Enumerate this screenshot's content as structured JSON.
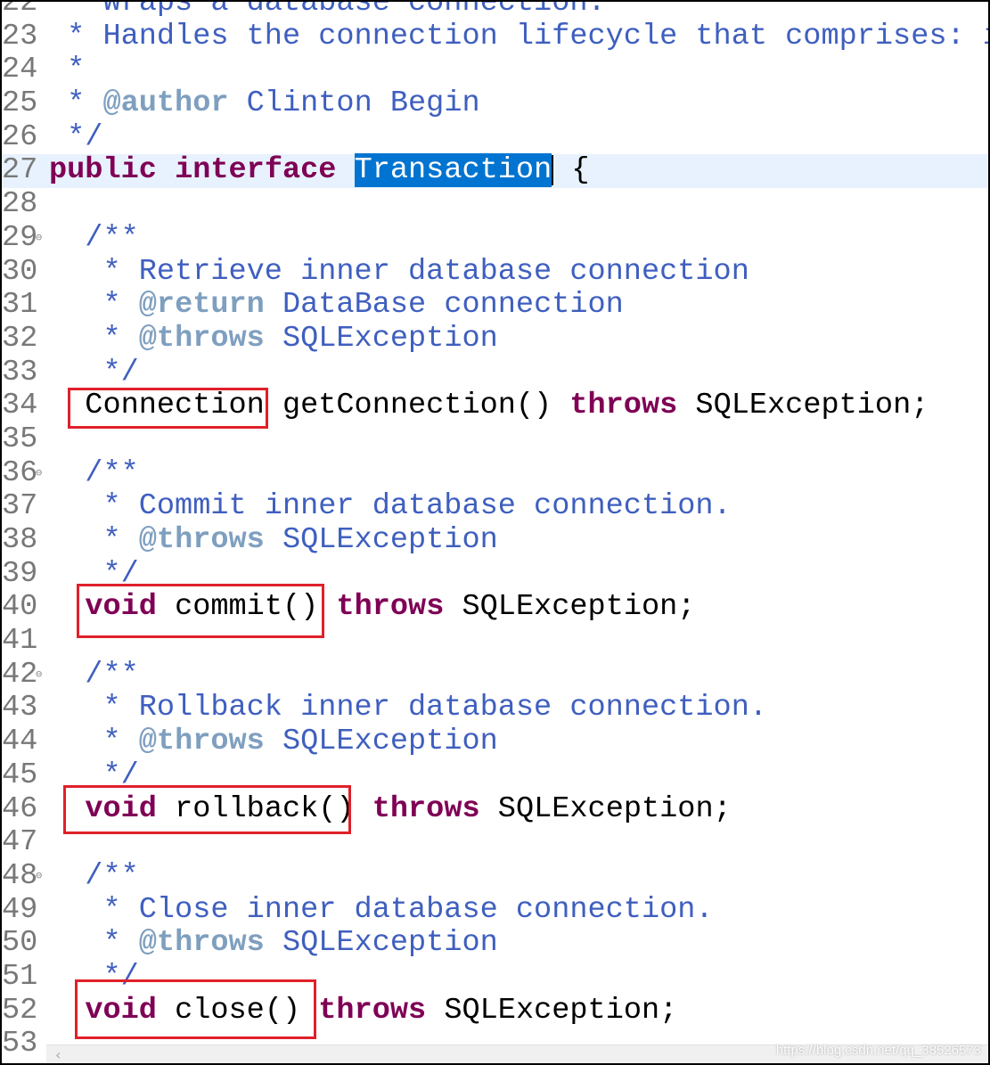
{
  "colors": {
    "comment": "#3f5fbf",
    "javadoc_tag": "#7f9fbf",
    "keyword": "#7f0055",
    "selection": "#0074d0",
    "current_line": "#e8f2fe",
    "highlight_box": "#e0202a"
  },
  "lines": [
    {
      "num": "22",
      "tokens": [
        {
          "c": "cm",
          "t": " * Wraps a database connection."
        }
      ]
    },
    {
      "num": "23",
      "tokens": [
        {
          "c": "cm",
          "t": " * Handles the connection lifecycle that comprises: its"
        }
      ]
    },
    {
      "num": "24",
      "tokens": [
        {
          "c": "cm",
          "t": " *"
        }
      ]
    },
    {
      "num": "25",
      "tokens": [
        {
          "c": "cm",
          "t": " * "
        },
        {
          "c": "tag",
          "t": "@author"
        },
        {
          "c": "cm",
          "t": " Clinton Begin"
        }
      ]
    },
    {
      "num": "26",
      "tokens": [
        {
          "c": "cm",
          "t": " */"
        }
      ]
    },
    {
      "num": "27",
      "current": true,
      "tokens": [
        {
          "c": "kw",
          "t": "public"
        },
        {
          "c": "pl",
          "t": " "
        },
        {
          "c": "kw",
          "t": "interface"
        },
        {
          "c": "pl",
          "t": " "
        },
        {
          "c": "sel",
          "t": "Transaction"
        },
        {
          "c": "caret",
          "t": ""
        },
        {
          "c": "pl",
          "t": " {"
        }
      ]
    },
    {
      "num": "28",
      "tokens": []
    },
    {
      "num": "29",
      "fold": true,
      "tokens": [
        {
          "c": "cm",
          "t": "  /**"
        }
      ]
    },
    {
      "num": "30",
      "tokens": [
        {
          "c": "cm",
          "t": "   * Retrieve inner database connection"
        }
      ]
    },
    {
      "num": "31",
      "tokens": [
        {
          "c": "cm",
          "t": "   * "
        },
        {
          "c": "tag",
          "t": "@return"
        },
        {
          "c": "cm",
          "t": " DataBase connection"
        }
      ]
    },
    {
      "num": "32",
      "tokens": [
        {
          "c": "cm",
          "t": "   * "
        },
        {
          "c": "tag",
          "t": "@throws"
        },
        {
          "c": "cm",
          "t": " SQLException"
        }
      ]
    },
    {
      "num": "33",
      "tokens": [
        {
          "c": "cm",
          "t": "   */"
        }
      ]
    },
    {
      "num": "34",
      "tokens": [
        {
          "c": "pl",
          "t": "  Connection getConnection() "
        },
        {
          "c": "kw",
          "t": "throws"
        },
        {
          "c": "pl",
          "t": " SQLException;"
        }
      ]
    },
    {
      "num": "35",
      "tokens": []
    },
    {
      "num": "36",
      "fold": true,
      "tokens": [
        {
          "c": "cm",
          "t": "  /**"
        }
      ]
    },
    {
      "num": "37",
      "tokens": [
        {
          "c": "cm",
          "t": "   * Commit inner database connection."
        }
      ]
    },
    {
      "num": "38",
      "tokens": [
        {
          "c": "cm",
          "t": "   * "
        },
        {
          "c": "tag",
          "t": "@throws"
        },
        {
          "c": "cm",
          "t": " SQLException"
        }
      ]
    },
    {
      "num": "39",
      "tokens": [
        {
          "c": "cm",
          "t": "   */"
        }
      ]
    },
    {
      "num": "40",
      "tokens": [
        {
          "c": "pl",
          "t": "  "
        },
        {
          "c": "kw",
          "t": "void"
        },
        {
          "c": "pl",
          "t": " commit() "
        },
        {
          "c": "kw",
          "t": "throws"
        },
        {
          "c": "pl",
          "t": " SQLException;"
        }
      ]
    },
    {
      "num": "41",
      "tokens": []
    },
    {
      "num": "42",
      "fold": true,
      "tokens": [
        {
          "c": "cm",
          "t": "  /**"
        }
      ]
    },
    {
      "num": "43",
      "tokens": [
        {
          "c": "cm",
          "t": "   * Rollback inner database connection."
        }
      ]
    },
    {
      "num": "44",
      "tokens": [
        {
          "c": "cm",
          "t": "   * "
        },
        {
          "c": "tag",
          "t": "@throws"
        },
        {
          "c": "cm",
          "t": " SQLException"
        }
      ]
    },
    {
      "num": "45",
      "tokens": [
        {
          "c": "cm",
          "t": "   */"
        }
      ]
    },
    {
      "num": "46",
      "tokens": [
        {
          "c": "pl",
          "t": "  "
        },
        {
          "c": "kw",
          "t": "void"
        },
        {
          "c": "pl",
          "t": " rollback() "
        },
        {
          "c": "kw",
          "t": "throws"
        },
        {
          "c": "pl",
          "t": " SQLException;"
        }
      ]
    },
    {
      "num": "47",
      "tokens": []
    },
    {
      "num": "48",
      "fold": true,
      "tokens": [
        {
          "c": "cm",
          "t": "  /**"
        }
      ]
    },
    {
      "num": "49",
      "tokens": [
        {
          "c": "cm",
          "t": "   * Close inner database connection."
        }
      ]
    },
    {
      "num": "50",
      "tokens": [
        {
          "c": "cm",
          "t": "   * "
        },
        {
          "c": "tag",
          "t": "@throws"
        },
        {
          "c": "cm",
          "t": " SQLException"
        }
      ]
    },
    {
      "num": "51",
      "tokens": [
        {
          "c": "cm",
          "t": "   */"
        }
      ]
    },
    {
      "num": "52",
      "tokens": [
        {
          "c": "pl",
          "t": "  "
        },
        {
          "c": "kw",
          "t": "void"
        },
        {
          "c": "pl",
          "t": " close() "
        },
        {
          "c": "kw",
          "t": "throws"
        },
        {
          "c": "pl",
          "t": " SQLException;"
        }
      ]
    },
    {
      "num": "53",
      "tokens": []
    }
  ],
  "watermark": "https://blog.csdn.net/qq_38526573",
  "scrollbar": {
    "left_arrow": "‹"
  }
}
